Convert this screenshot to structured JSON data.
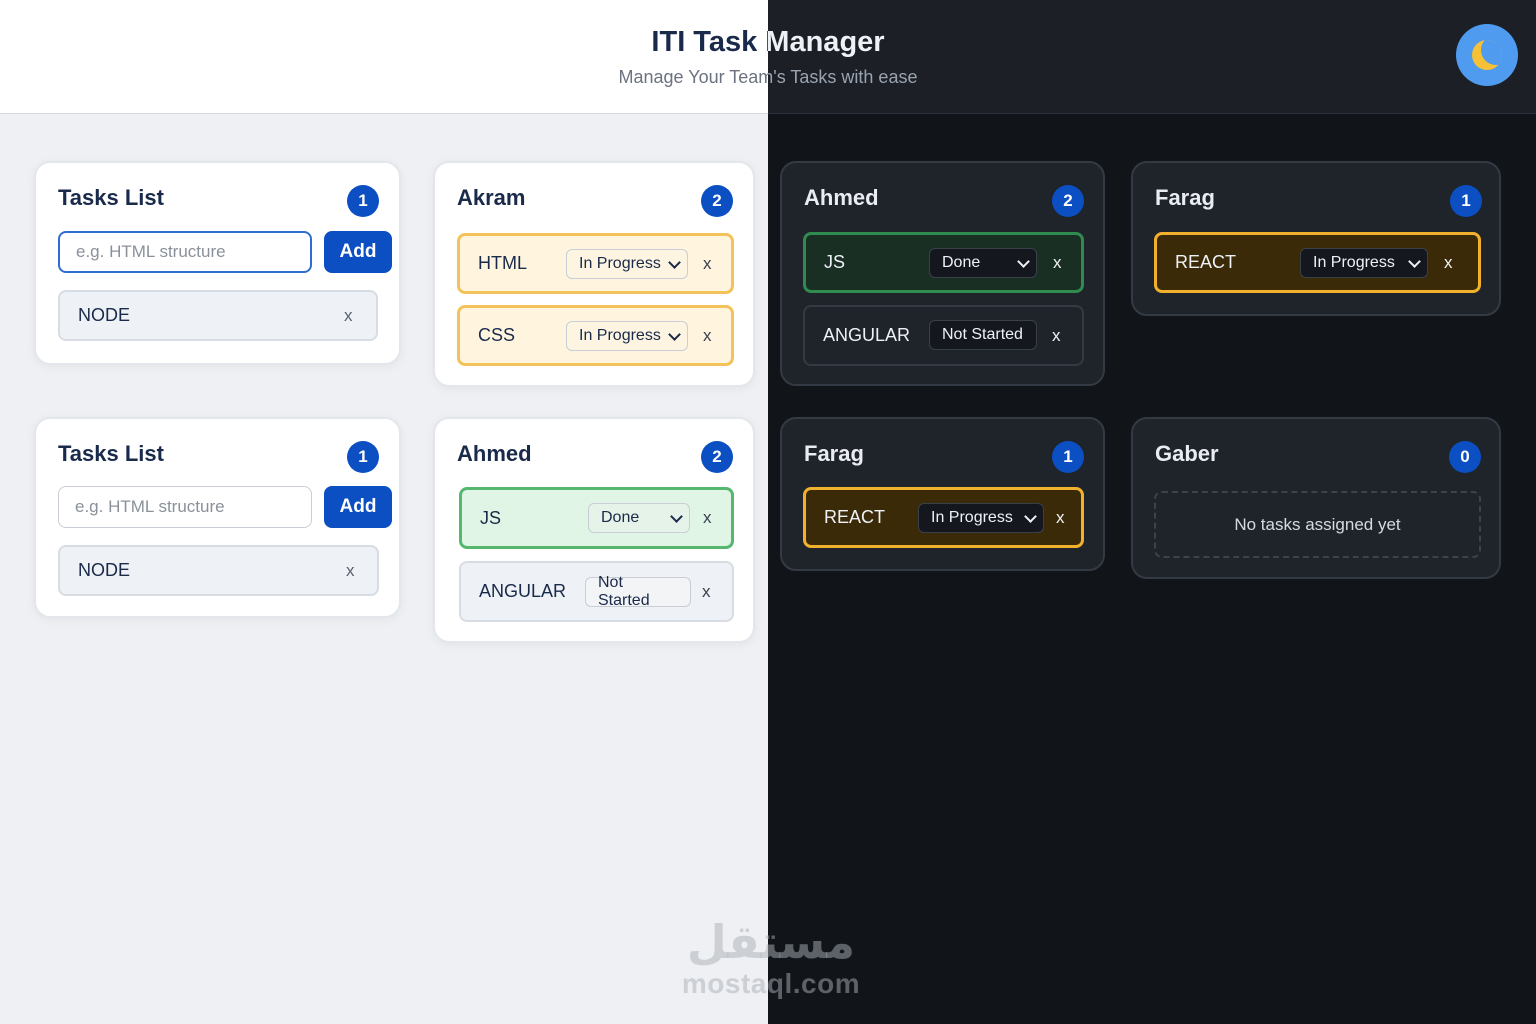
{
  "header": {
    "title": "ITI Task Manager",
    "subtitle": "Manage Your Team's Tasks with ease",
    "theme_icon": "moon-icon"
  },
  "tasks_list": {
    "title": "Tasks List",
    "count": "1",
    "input_placeholder": "e.g. HTML structure",
    "add_label": "Add",
    "items": [
      {
        "name": "NODE",
        "remove": "x"
      }
    ]
  },
  "members": {
    "akram": {
      "name": "Akram",
      "count": "2",
      "tasks": [
        {
          "name": "HTML",
          "status": "In Progress",
          "remove": "x"
        },
        {
          "name": "CSS",
          "status": "In Progress",
          "remove": "x"
        }
      ]
    },
    "ahmed": {
      "name": "Ahmed",
      "count": "2",
      "tasks": [
        {
          "name": "JS",
          "status": "Done",
          "remove": "x"
        },
        {
          "name": "ANGULAR",
          "status": "Not Started",
          "remove": "x"
        }
      ]
    },
    "farag": {
      "name": "Farag",
      "count": "1",
      "tasks": [
        {
          "name": "REACT",
          "status": "In Progress",
          "remove": "x"
        }
      ]
    },
    "gaber": {
      "name": "Gaber",
      "count": "0",
      "empty_text": "No tasks assigned yet"
    }
  },
  "watermark": {
    "arabic": "مستقل",
    "latin": "mostaql.com"
  },
  "colors": {
    "accent": "#0b4fc2",
    "in_progress": "#f2b12c",
    "done": "#2f8c4e",
    "dark_bg": "#111418",
    "light_bg": "#eef0f3"
  }
}
